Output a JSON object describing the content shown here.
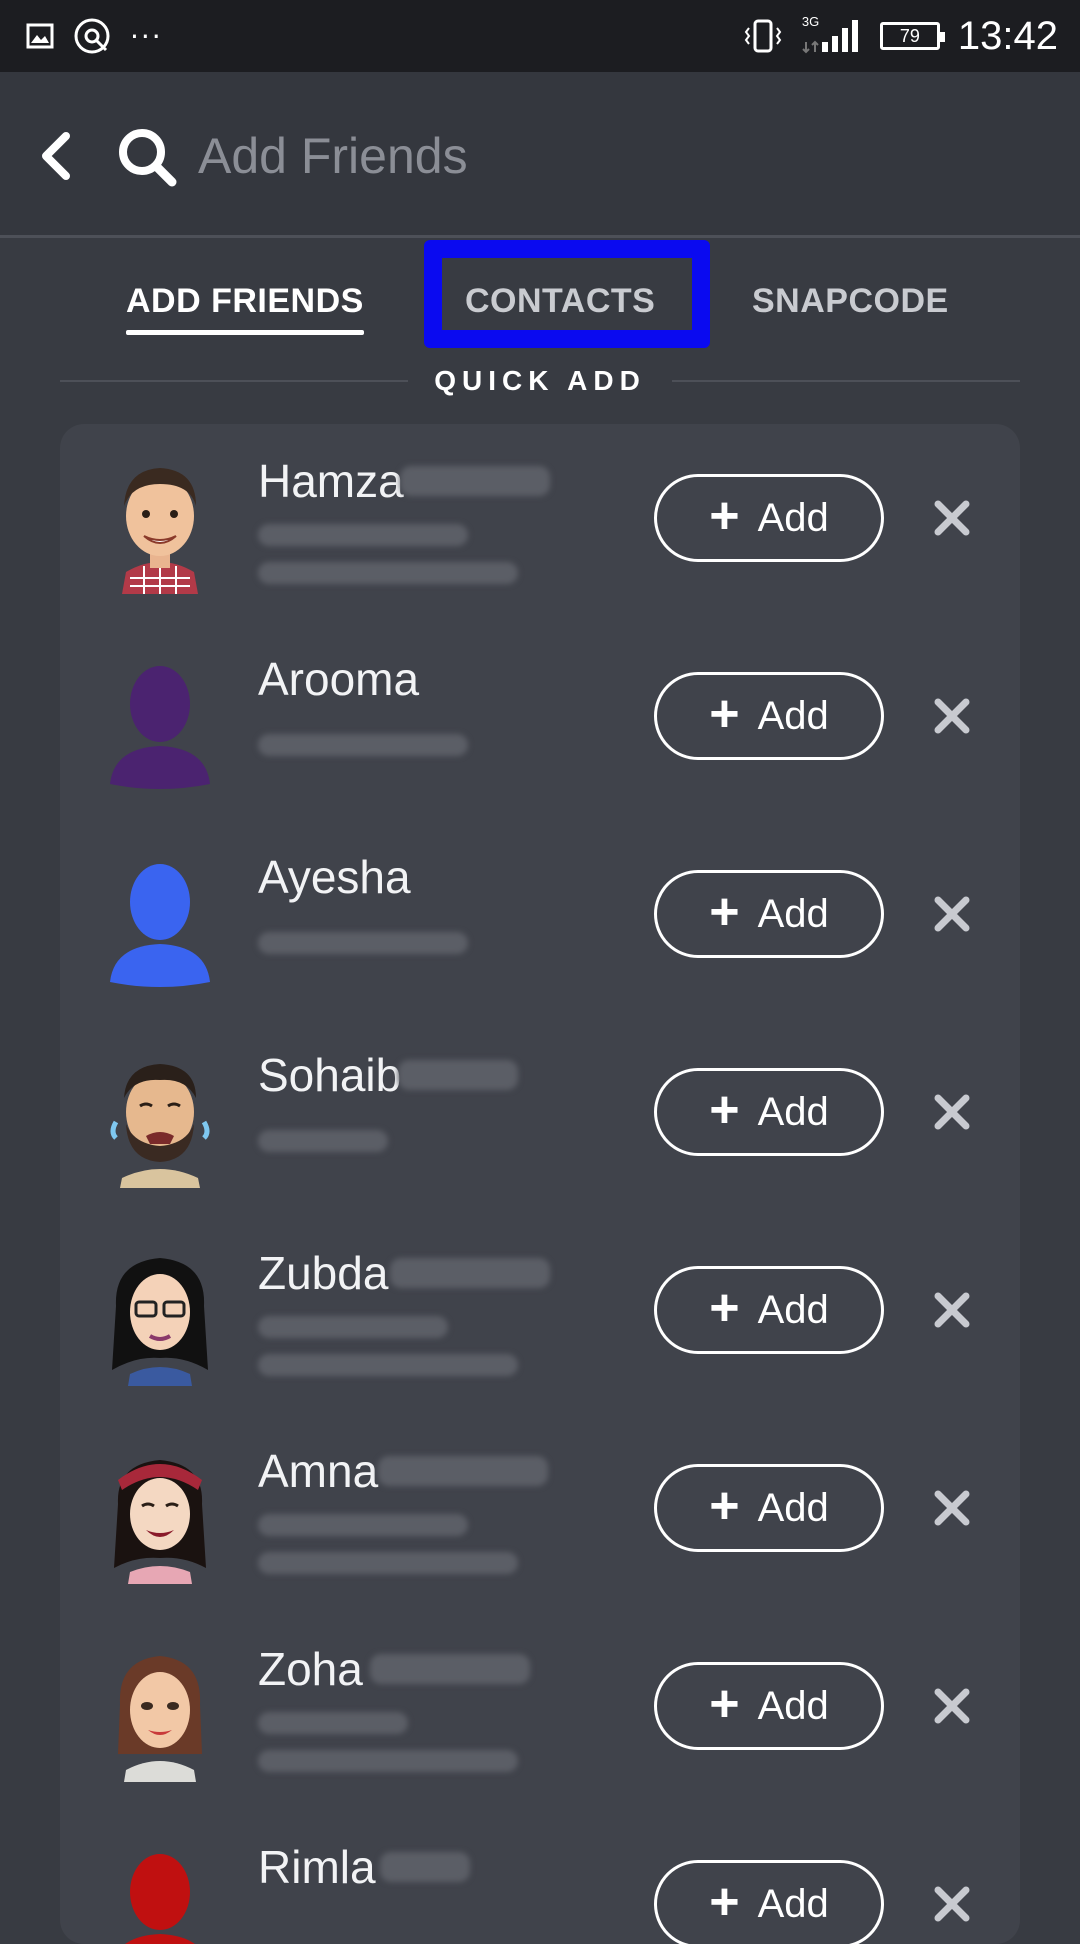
{
  "status_bar": {
    "time": "13:42",
    "battery": "79",
    "network": "3G",
    "icons": [
      "image-icon",
      "sync-icon",
      "more-dots-icon",
      "vibrate-icon",
      "data-arrows-icon",
      "signal-icon",
      "battery-icon"
    ]
  },
  "header": {
    "search_placeholder": "Add Friends"
  },
  "tabs": [
    {
      "label": "ADD FRIENDS",
      "active": true
    },
    {
      "label": "CONTACTS",
      "active": false,
      "highlighted": true
    },
    {
      "label": "SNAPCODE",
      "active": false
    }
  ],
  "section": {
    "label": "QUICK ADD"
  },
  "friends": [
    {
      "name": "Hamza",
      "add_label": "Add"
    },
    {
      "name": "Arooma",
      "add_label": "Add"
    },
    {
      "name": "Ayesha",
      "add_label": "Add"
    },
    {
      "name": "Sohaib",
      "add_label": "Add"
    },
    {
      "name": "Zubda",
      "add_label": "Add"
    },
    {
      "name": "Amna",
      "add_label": "Add"
    },
    {
      "name": "Zoha",
      "add_label": "Add"
    },
    {
      "name": "Rimla",
      "add_label": "Add"
    }
  ],
  "colors": {
    "background": "#383b42",
    "card": "#40434b",
    "highlight": "#0a0af0",
    "avatar_purple": "#4b2370",
    "avatar_blue": "#3a64f0",
    "avatar_red": "#c01010"
  }
}
